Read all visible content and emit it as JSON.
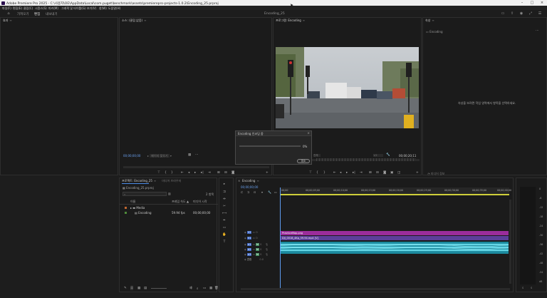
{
  "titlebar": {
    "title": "Adobe Premiere Pro 2025 - C:\\사용자\\OE\\AppData\\Local\\com.puget\\benchmark\\assets\\premierepro-projects-1.0.2\\Encoding_25.prproj",
    "minimize": "–",
    "maximize": "□",
    "close": "×"
  },
  "menubar": [
    "파일(F)",
    "편집(E)",
    "클립(C)",
    "시퀀스(S)",
    "마커(M)",
    "그래픽 및 타이틀(G)",
    "보기(V)",
    "창(W)",
    "도움말(H)"
  ],
  "header": {
    "workspaces": [
      "가져오기",
      "편집",
      "내보내기"
    ],
    "active_workspace": "편집",
    "project_name": "Encoding_25"
  },
  "panels": {
    "effects": {
      "title": "효과",
      "close": "≡"
    },
    "source": {
      "title": "소스: (클립 없음)",
      "close": "≡",
      "timecode": "00;00;00;00",
      "page": "페이지 맞추기"
    },
    "program": {
      "title": "프로그램: Encoding",
      "close": "≡",
      "timecode_right": "00;00;20;11",
      "fit": "전체",
      "zoom": "1/2"
    },
    "properties": {
      "title": "속성",
      "close": "≡",
      "item": "Encoding",
      "empty_message": "속성을 보려면 작업 영역에서 항목을 선택하세요.",
      "footer": "미디어 정보"
    }
  },
  "project_panel": {
    "tabs": [
      "프로젝트: Encoding_25",
      "미디어 브라우저"
    ],
    "file": "Encoding_25.prproj",
    "search_placeholder": "",
    "count": "2 항목",
    "columns": {
      "name": "이름",
      "frame_rate": "프레임 속도",
      "media_start": "미디어 시작"
    },
    "rows": [
      {
        "name": "Media",
        "fps": "",
        "start": "",
        "color": "#c0662f",
        "type": "folder"
      },
      {
        "name": "Encoding",
        "fps": "59.94 fps",
        "start": "00;00;00;00",
        "color": "#4f8a3a",
        "type": "sequence"
      }
    ]
  },
  "timeline": {
    "tab": "Encoding",
    "close": "≡",
    "timecode": "00;00;00;00",
    "ruler": [
      "00;00",
      "00;00;05;00",
      "00;00;10;00",
      "00;00;15;00",
      "00;00;20;00",
      "00;00;25;00",
      "00;00;30;00",
      "00;00;35;00",
      "00;00;40;00"
    ],
    "tracks": {
      "v2": "V2",
      "v1": "V1",
      "a1": "A1",
      "a2": "A2",
      "a3": "A3",
      "mix": "혼합",
      "mix_val": "0.0",
      "v_lock_o": "O",
      "a_m": "M",
      "a_s": "S"
    },
    "clips": {
      "v2": "PracticeMap.png",
      "v1": "DJI_0018_4Kp_59.94.mp4 [V]"
    }
  },
  "dialog": {
    "title": "Encoding 인코딩 중",
    "percent": "0%",
    "cancel": "취소",
    "progress": 0
  },
  "meter_labels": [
    "0",
    "-6",
    "-12",
    "-18",
    "-24",
    "-30",
    "-36",
    "-42",
    "-48",
    "-54",
    "dB"
  ],
  "meter_footer": [
    "S",
    "S"
  ],
  "colors": {
    "accent": "#4c8ce6",
    "clip_v2": "#9b2d9b",
    "clip_v1": "#5c3f9a",
    "clip_audio": "#1c8a9e",
    "timecode": "#6aa1f0"
  }
}
